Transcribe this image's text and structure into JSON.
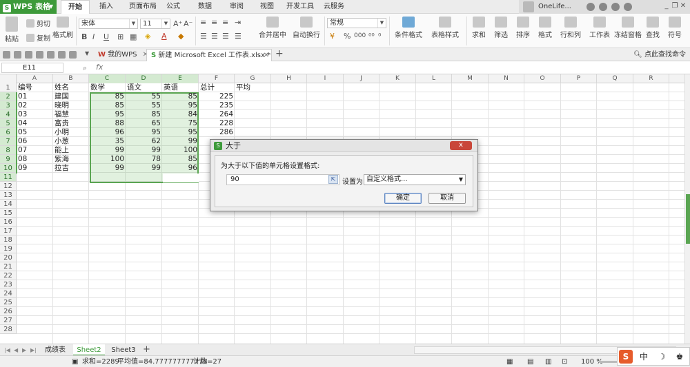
{
  "app": {
    "name": "WPS 表格",
    "logo_letter": "S"
  },
  "menu": {
    "tabs": [
      {
        "label": "开始",
        "active": true
      },
      {
        "label": "插入"
      },
      {
        "label": "页面布局"
      },
      {
        "label": "公式"
      },
      {
        "label": "数据"
      },
      {
        "label": "审阅"
      },
      {
        "label": "视图"
      },
      {
        "label": "开发工具"
      },
      {
        "label": "云服务"
      }
    ],
    "user_name": "OneLife..."
  },
  "ribbon": {
    "paste": "粘贴",
    "cut": "剪切",
    "copy": "复制",
    "format_painter": "格式刷",
    "font_name": "宋体",
    "font_size": "11",
    "merge_center": "合并居中",
    "wrap_text": "自动换行",
    "number_format": "常规",
    "conditional_format": "条件格式",
    "table_style": "表格样式",
    "sum": "求和",
    "filter": "筛选",
    "sort": "排序",
    "format": "格式",
    "row_col": "行和列",
    "worksheet": "工作表",
    "freeze": "冻结窗格",
    "find": "查找",
    "symbol": "符号",
    "bold": "B",
    "italic": "I",
    "underline": "U",
    "font_color": "A",
    "percent": "%",
    "comma": "000"
  },
  "tabbar": {
    "tabs": [
      {
        "label": "我的WPS",
        "active": false
      },
      {
        "label": "新建 Microsoft Excel 工作表.xlsx *",
        "active": true
      }
    ],
    "search_cmd": "点此查找命令",
    "new_tab": "+"
  },
  "formula": {
    "name_box": "E11",
    "fx": "fx"
  },
  "columns": [
    "A",
    "B",
    "C",
    "D",
    "E",
    "F",
    "G",
    "H",
    "I",
    "J",
    "K",
    "L",
    "M",
    "N",
    "O",
    "P",
    "Q",
    "R"
  ],
  "rows": [
    "1",
    "2",
    "3",
    "4",
    "5",
    "6",
    "7",
    "8",
    "9",
    "10",
    "11",
    "12",
    "13",
    "14",
    "15",
    "16",
    "17",
    "18",
    "19",
    "20",
    "21",
    "22",
    "23",
    "24",
    "25",
    "26",
    "27",
    "28"
  ],
  "sheet": {
    "headers": [
      "编号",
      "姓名",
      "数学",
      "语文",
      "英语",
      "总计",
      "平均"
    ],
    "data": [
      [
        "01",
        "建国",
        "85",
        "55",
        "85",
        "225"
      ],
      [
        "02",
        "晓明",
        "85",
        "55",
        "95",
        "235"
      ],
      [
        "03",
        "福慧",
        "95",
        "85",
        "84",
        "264"
      ],
      [
        "04",
        "富贵",
        "88",
        "65",
        "75",
        "228"
      ],
      [
        "05",
        "小明",
        "96",
        "95",
        "95",
        "286"
      ],
      [
        "06",
        "小葱",
        "35",
        "62",
        "99",
        ""
      ],
      [
        "07",
        "能上",
        "99",
        "99",
        "100",
        ""
      ],
      [
        "08",
        "紫海",
        "100",
        "78",
        "85",
        ""
      ],
      [
        "09",
        "拉吉",
        "99",
        "99",
        "96",
        ""
      ]
    ]
  },
  "dialog": {
    "title": "大于",
    "prompt": "为大于以下值的单元格设置格式:",
    "value": "90",
    "set_as_label": "设置为",
    "format_option": "自定义格式...",
    "ok": "确定",
    "cancel": "取消",
    "close": "x"
  },
  "sheet_tabs": [
    {
      "label": "成绩表",
      "active": false
    },
    {
      "label": "Sheet2",
      "active": true
    },
    {
      "label": "Sheet3",
      "active": false
    }
  ],
  "add_sheet": "+",
  "status": {
    "sum": "求和=2289",
    "average": "平均值=84.777777777778",
    "count": "计数=27",
    "zoom": "100 %"
  },
  "ime": {
    "lang": "中",
    "moon": "☽",
    "shirt": "♚",
    "wps": "S"
  }
}
